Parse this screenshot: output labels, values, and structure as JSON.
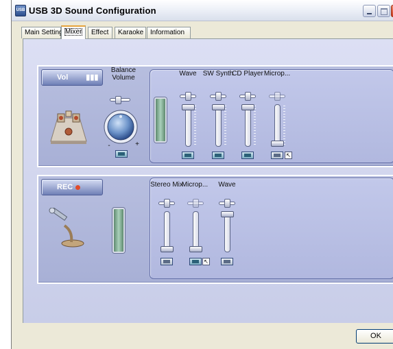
{
  "window": {
    "title": "USB 3D Sound Configuration",
    "app_icon_text": "USB"
  },
  "tabs": [
    {
      "label": "Main Setting",
      "active": false
    },
    {
      "label": "Mixer",
      "active": true
    },
    {
      "label": "Effect",
      "active": false
    },
    {
      "label": "Karaoke",
      "active": false
    },
    {
      "label": "Information",
      "active": false
    }
  ],
  "playback": {
    "badge": "Vol",
    "master_label": "Balance Volume",
    "channels": [
      {
        "label": "Wave",
        "volume": 0.9,
        "muted": false
      },
      {
        "label": "SW Synth",
        "volume": 0.9,
        "muted": false
      },
      {
        "label": "CD Player",
        "volume": 0.9,
        "muted": false
      },
      {
        "label": "Microp...",
        "volume": 0.0,
        "muted": true
      }
    ]
  },
  "recording": {
    "badge": "REC",
    "channels": [
      {
        "label": "Stereo Mix",
        "volume": 0.0,
        "selected": false
      },
      {
        "label": "Microp...",
        "volume": 0.0,
        "selected": true
      },
      {
        "label": "Wave",
        "volume": 1.0,
        "selected": false
      }
    ]
  },
  "buttons": {
    "ok": "OK"
  },
  "icons": {
    "balance_knob": "volume-knob-icon",
    "speaker_scene": "speaker-stage-icon",
    "microphone": "microphone-icon",
    "select": "cursor-select-icon"
  },
  "colors": {
    "titlebar": "#eef1f8",
    "panel": "#b1b8df",
    "meter": "#a9d0ba",
    "accent_tab": "#e7a33a"
  }
}
